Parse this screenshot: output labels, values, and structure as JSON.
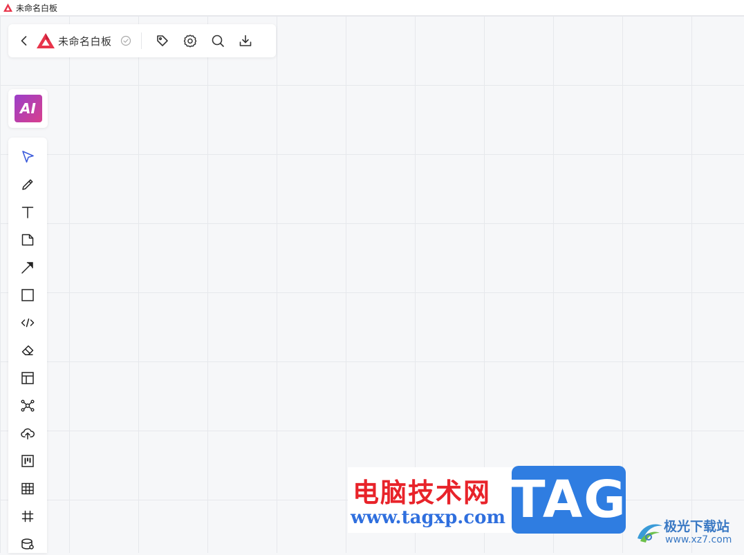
{
  "window": {
    "title": "未命名白板"
  },
  "header": {
    "board_title": "未命名白板",
    "icons": [
      "back-icon",
      "logo-icon",
      "saved-check-icon",
      "tag-icon",
      "settings-icon",
      "search-icon",
      "download-icon"
    ]
  },
  "ai": {
    "label": "AI"
  },
  "toolbar": {
    "tools": [
      "select",
      "pen",
      "text",
      "sticky-note",
      "arrow",
      "rectangle",
      "code",
      "eraser",
      "layout",
      "mind-map",
      "upload",
      "kanban",
      "table",
      "frame",
      "more"
    ]
  },
  "watermark": {
    "site_name": "电脑技术网",
    "site_url": "www.tagxp.com",
    "tag_label": "TAG",
    "brand_name": "极光下载站",
    "brand_url": "www.xz7.com"
  },
  "colors": {
    "accent": "#e8354b",
    "selected_tool": "#3b5bdb",
    "ai_gradient_start": "#9b3fc9",
    "ai_gradient_end": "#d83f8d",
    "watermark_red": "#e8232a",
    "watermark_blue": "#2f7de1"
  }
}
